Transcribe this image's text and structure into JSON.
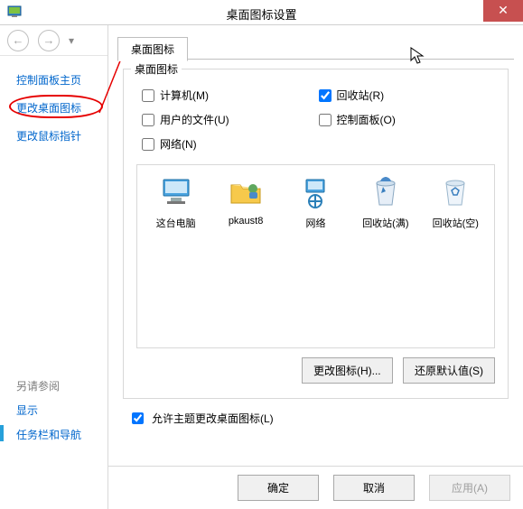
{
  "window": {
    "title": "桌面图标设置",
    "close_glyph": "✕"
  },
  "sidebar": {
    "items": [
      {
        "label": "控制面板主页"
      },
      {
        "label": "更改桌面图标"
      },
      {
        "label": "更改鼠标指针"
      }
    ],
    "see_also_header": "另请参阅",
    "see_also": [
      {
        "label": "显示"
      },
      {
        "label": "任务栏和导航"
      }
    ]
  },
  "tab": {
    "label": "桌面图标"
  },
  "group": {
    "title": "桌面图标",
    "checks": [
      {
        "label": "计算机(M)",
        "checked": false
      },
      {
        "label": "回收站(R)",
        "checked": true
      },
      {
        "label": "用户的文件(U)",
        "checked": false
      },
      {
        "label": "控制面板(O)",
        "checked": false
      },
      {
        "label": "网络(N)",
        "checked": false
      }
    ],
    "icons": [
      {
        "name": "computer-icon",
        "label": "这台电脑"
      },
      {
        "name": "user-folder-icon",
        "label": "pkaust8"
      },
      {
        "name": "network-icon",
        "label": "网络"
      },
      {
        "name": "recycle-full-icon",
        "label": "回收站(满)"
      },
      {
        "name": "recycle-empty-icon",
        "label": "回收站(空)"
      }
    ],
    "change_icon_btn": "更改图标(H)...",
    "restore_btn": "还原默认值(S)"
  },
  "allow_row": {
    "label": "允许主题更改桌面图标(L)",
    "checked": true
  },
  "footer": {
    "ok": "确定",
    "cancel": "取消",
    "apply": "应用(A)"
  }
}
